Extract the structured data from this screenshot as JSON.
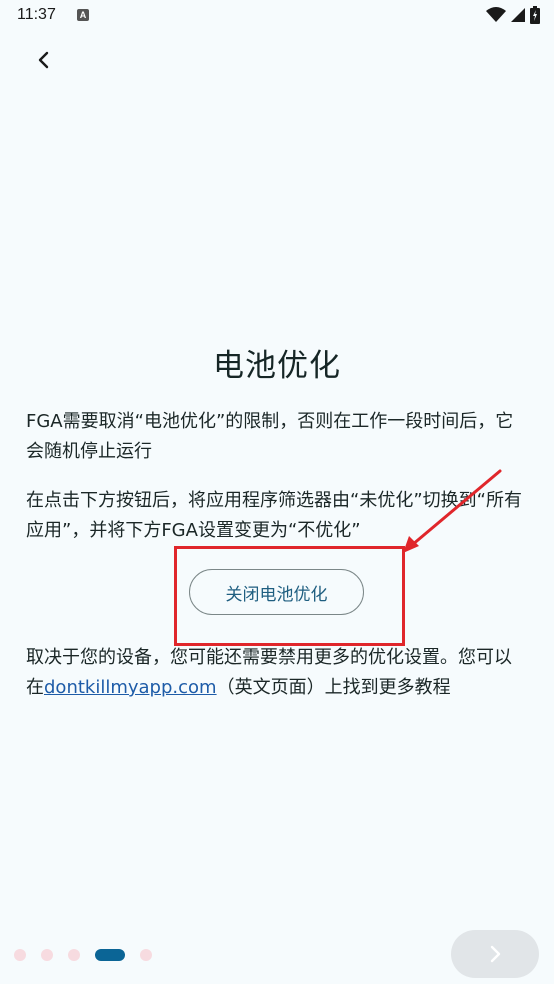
{
  "status_bar": {
    "time": "11:37",
    "app_indicator": "A",
    "icons": [
      "wifi-icon",
      "signal-icon",
      "battery-icon"
    ]
  },
  "nav": {
    "back_icon": "chevron-left-icon"
  },
  "title": "电池优化",
  "paragraph1": "FGA需要取消“电池优化”的限制，否则在工作一段时间后，它会随机停止运行",
  "paragraph2": "在点击下方按钮后，将应用程序筛选器由“未优化”切换到“所有应用”，并将下方FGA设置变更为“不优化”",
  "battery_button_label": "关闭电池优化",
  "paragraph3": {
    "before_link": "取决于您的设备，您可能还需要禁用更多的优化设置。您可以在",
    "link_text": "dontkillmyapp.com",
    "after_link": "（英文页面）上找到更多教程"
  },
  "pager": {
    "page_count": 5,
    "current_page": 4,
    "next_icon": "chevron-right-icon"
  },
  "colors": {
    "background": "#f6fbfd",
    "accent": "#0b6596",
    "link": "#1e5ca8",
    "annotation": "#e0262b",
    "inactive_dot": "#f7dbe0"
  }
}
